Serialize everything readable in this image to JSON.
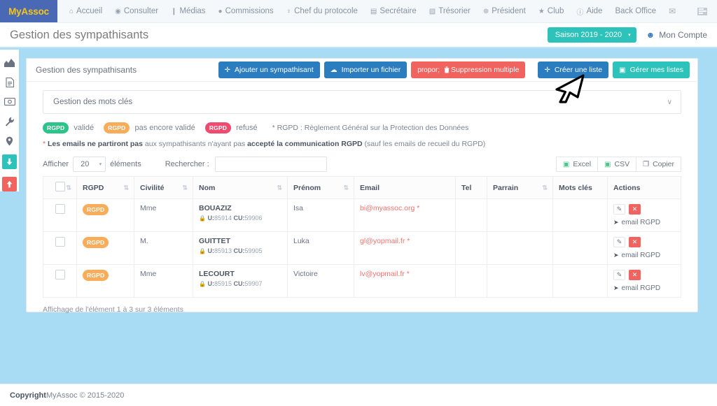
{
  "topnav": {
    "brand": "MyAssoc",
    "items": [
      {
        "label": "Accueil",
        "icon": "home-icon",
        "glyph": "⌂"
      },
      {
        "label": "Consulter",
        "icon": "eye-icon",
        "glyph": "◉"
      },
      {
        "label": "Médias",
        "icon": "file-icon",
        "glyph": "❙"
      },
      {
        "label": "Commissions",
        "icon": "globe-icon",
        "glyph": "●"
      },
      {
        "label": "Chef du protocole",
        "icon": "trophy-icon",
        "glyph": "♀"
      },
      {
        "label": "Secrétaire",
        "icon": "book-icon",
        "glyph": "▤"
      },
      {
        "label": "Trésorier",
        "icon": "money-icon",
        "glyph": "▧"
      },
      {
        "label": "Président",
        "icon": "globe-icon",
        "glyph": "⊕"
      },
      {
        "label": "Club",
        "icon": "star-icon",
        "glyph": "★"
      },
      {
        "label": "Aide",
        "icon": "info-icon",
        "glyph": "ⓘ"
      },
      {
        "label": "Back Office",
        "icon": "none",
        "glyph": ""
      },
      {
        "label": "",
        "icon": "envelope-icon",
        "glyph": "✉"
      }
    ],
    "menu_toggle_icon": "list-menu-icon"
  },
  "subheader": {
    "page_title": "Gestion des sympathisants",
    "season_label": "Saison 2019 - 2020",
    "season_caret": "▾",
    "account_label": "Mon Compte",
    "account_icon": "person-icon"
  },
  "rail": {
    "items": [
      {
        "name": "chart-icon",
        "glyph": "◢"
      },
      {
        "name": "document-icon",
        "glyph": "❐"
      },
      {
        "name": "money-icon",
        "glyph": "▤"
      },
      {
        "name": "wrench-icon",
        "glyph": "⚒"
      },
      {
        "name": "location-pin-icon",
        "glyph": "⌕"
      }
    ],
    "download_glyph": "↓",
    "upload_glyph": "↑"
  },
  "card": {
    "title": "Gestion des sympathisants",
    "buttons": [
      {
        "label": "Ajouter un sympathisant",
        "icon": "plus-icon",
        "glyph": "＋",
        "style": "blue"
      },
      {
        "label": "Importer un fichier",
        "icon": "cloud-upload-icon",
        "glyph": "☁",
        "style": "blue"
      },
      {
        "label": "Suppression multiple",
        "icon": "trash-icon",
        "glyph": "Ὕ1",
        "style": "red"
      },
      {
        "label": "Créer une liste",
        "icon": "plus-icon",
        "glyph": "＋",
        "style": "blue2"
      },
      {
        "label": "Gérer mes listes",
        "icon": "list-icon",
        "glyph": "▣",
        "style": "teal"
      }
    ]
  },
  "keywords_panel": {
    "title": "Gestion des mots clés",
    "caret": "∨"
  },
  "legend": {
    "badge_label": "RGPD",
    "valide": "validé",
    "pas_encore": "pas encore validé",
    "refuse": "refusé",
    "note": "* RGPD : Règlement Général sur la Protection des Données",
    "warn_star": "*",
    "warn_bold_1": "Les emails ne partiront pas",
    "warn_mid": " aux sympathisants n'ayant pas ",
    "warn_bold_2": "accepté la communication RGPD",
    "warn_end": " (sauf les emails de recueil du RGPD)",
    "colors": {
      "green": "#2ec38a",
      "orange": "#f9ad5a",
      "red": "#ef4b6e"
    }
  },
  "controls": {
    "afficher_label": "Afficher",
    "page_size": "20",
    "elements_label": "éléments",
    "search_label": "Rechercher :",
    "search_value": "",
    "search_placeholder": "",
    "exports": [
      {
        "label": "Excel",
        "icon": "excel-icon",
        "glyph": "❑"
      },
      {
        "label": "CSV",
        "icon": "csv-icon",
        "glyph": "❑"
      },
      {
        "label": "Copier",
        "icon": "copy-icon",
        "glyph": "❐"
      }
    ]
  },
  "table": {
    "columns": [
      {
        "label": "",
        "sortable": false
      },
      {
        "label": "RGPD",
        "sortable": true
      },
      {
        "label": "Civilité",
        "sortable": true
      },
      {
        "label": "Nom",
        "sortable": true
      },
      {
        "label": "Prénom",
        "sortable": true
      },
      {
        "label": "Email",
        "sortable": false
      },
      {
        "label": "Tel",
        "sortable": false
      },
      {
        "label": "Parrain",
        "sortable": true
      },
      {
        "label": "Mots clés",
        "sortable": false
      },
      {
        "label": "Actions",
        "sortable": false
      }
    ],
    "rows": [
      {
        "rgpd": "RGPD",
        "civilite": "Mme",
        "nom": "BOUAZIZ",
        "ids": {
          "u_label": "U:",
          "u": "85914",
          "cu_label": "CU:",
          "cu": "59906"
        },
        "prenom": "Isa",
        "email": "bi@myassoc.org",
        "email_star": "*",
        "tel": "",
        "parrain": "",
        "mots_cles": "",
        "action_mail": "email RGPD"
      },
      {
        "rgpd": "RGPD",
        "civilite": "M.",
        "nom": "GUITTET",
        "ids": {
          "u_label": "U:",
          "u": "85913",
          "cu_label": "CU:",
          "cu": "59905"
        },
        "prenom": "Luka",
        "email": "gl@yopmail.fr",
        "email_star": "*",
        "tel": "",
        "parrain": "",
        "mots_cles": "",
        "action_mail": "email RGPD"
      },
      {
        "rgpd": "RGPD",
        "civilite": "Mme",
        "nom": "LECOURT",
        "ids": {
          "u_label": "U:",
          "u": "85915",
          "cu_label": "CU:",
          "cu": "59907"
        },
        "prenom": "Victoire",
        "email": "lv@yopmail.fr",
        "email_star": "*",
        "tel": "",
        "parrain": "",
        "mots_cles": "",
        "action_mail": "email RGPD"
      }
    ],
    "footer_info": "Affichage de l'élément 1 à 3 sur 3 éléments"
  },
  "footer": {
    "bold": "Copyright",
    "text": " MyAssoc © 2015-2020"
  }
}
